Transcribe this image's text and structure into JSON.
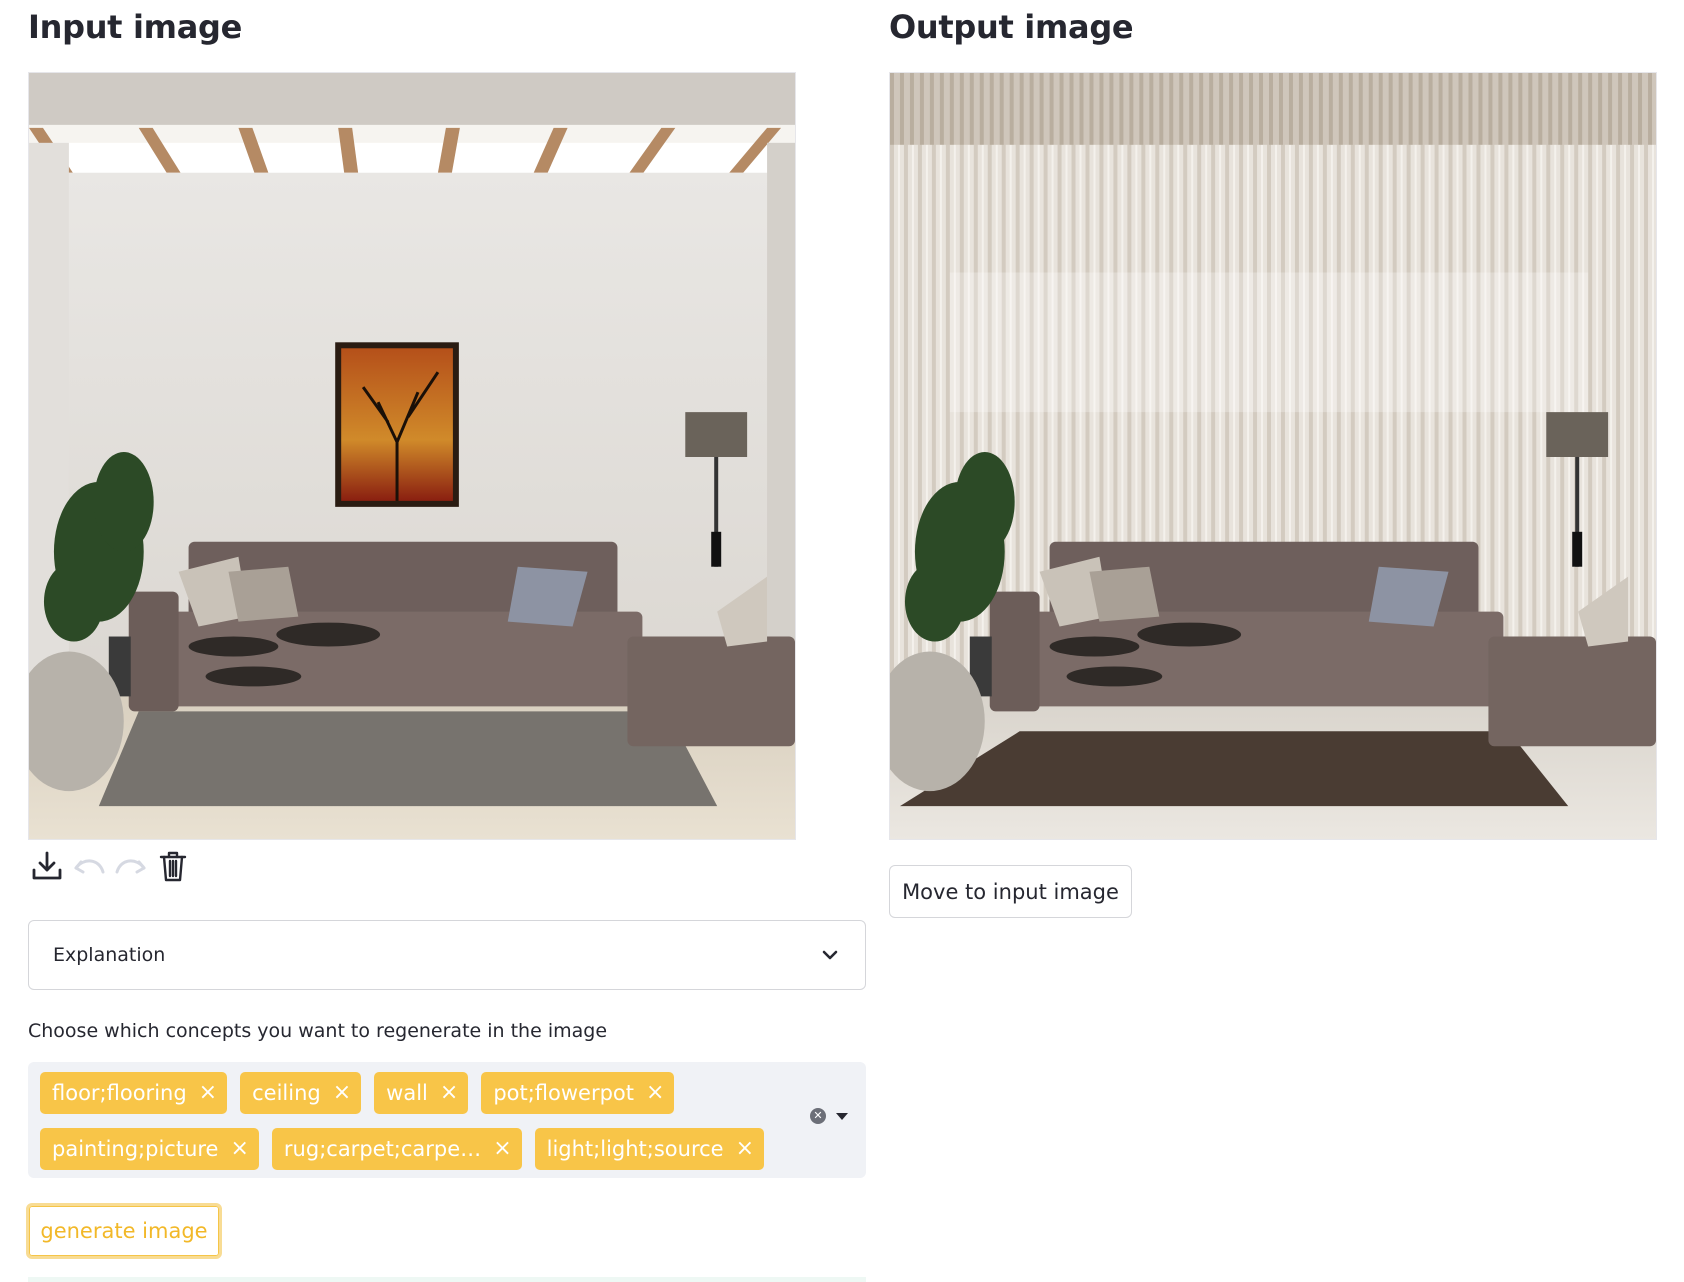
{
  "input_panel": {
    "title": "Input image",
    "toolbar": {
      "download_icon": "download-icon",
      "undo_icon": "undo-icon",
      "redo_icon": "redo-icon",
      "delete_icon": "trash-icon"
    }
  },
  "output_panel": {
    "title": "Output image",
    "move_button_label": "Move to input image"
  },
  "expander": {
    "label": "Explanation",
    "icon": "chevron-down-icon"
  },
  "concepts": {
    "label": "Choose which concepts you want to regenerate in the image",
    "selected": [
      "floor;flooring",
      "ceiling",
      "wall",
      "pot;flowerpot",
      "painting;picture",
      "rug;carpet;carpe…",
      "light;light;source"
    ],
    "remove_glyph": "×",
    "chip_color": "#f8c548"
  },
  "generate_button_label": "generate image",
  "colors": {
    "accent": "#f8c548",
    "text": "#262730",
    "input_bg": "#f0f2f6"
  }
}
